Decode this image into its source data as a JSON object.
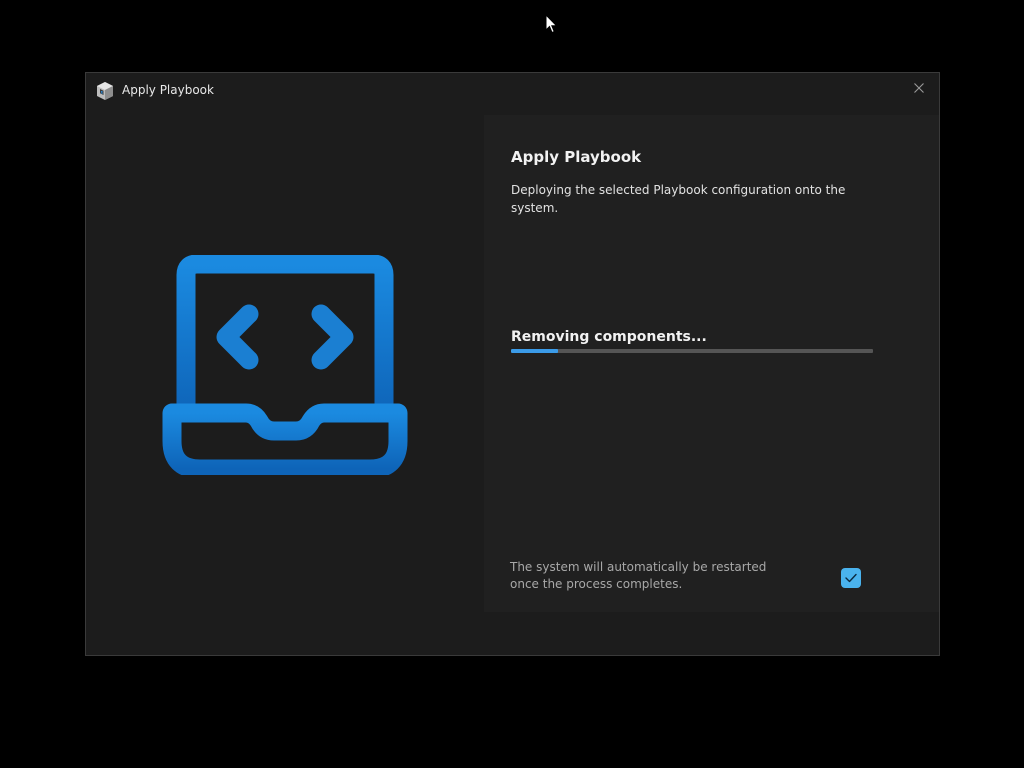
{
  "window": {
    "title": "Apply Playbook",
    "app_icon": "playbook-app-icon",
    "close_icon": "close-icon"
  },
  "main": {
    "heading": "Apply Playbook",
    "description": "Deploying the selected Playbook configuration onto the system.",
    "illustration": "laptop-code-icon",
    "status": "Removing components...",
    "progress_fraction": 0.13,
    "restart_note": "The system will automatically be restarted once the process completes.",
    "restart_checked": true
  },
  "colors": {
    "accent": "#3b9be8",
    "illustration_blue": "#1f7fd6",
    "background": "#1c1c1c",
    "panel": "#202020"
  }
}
